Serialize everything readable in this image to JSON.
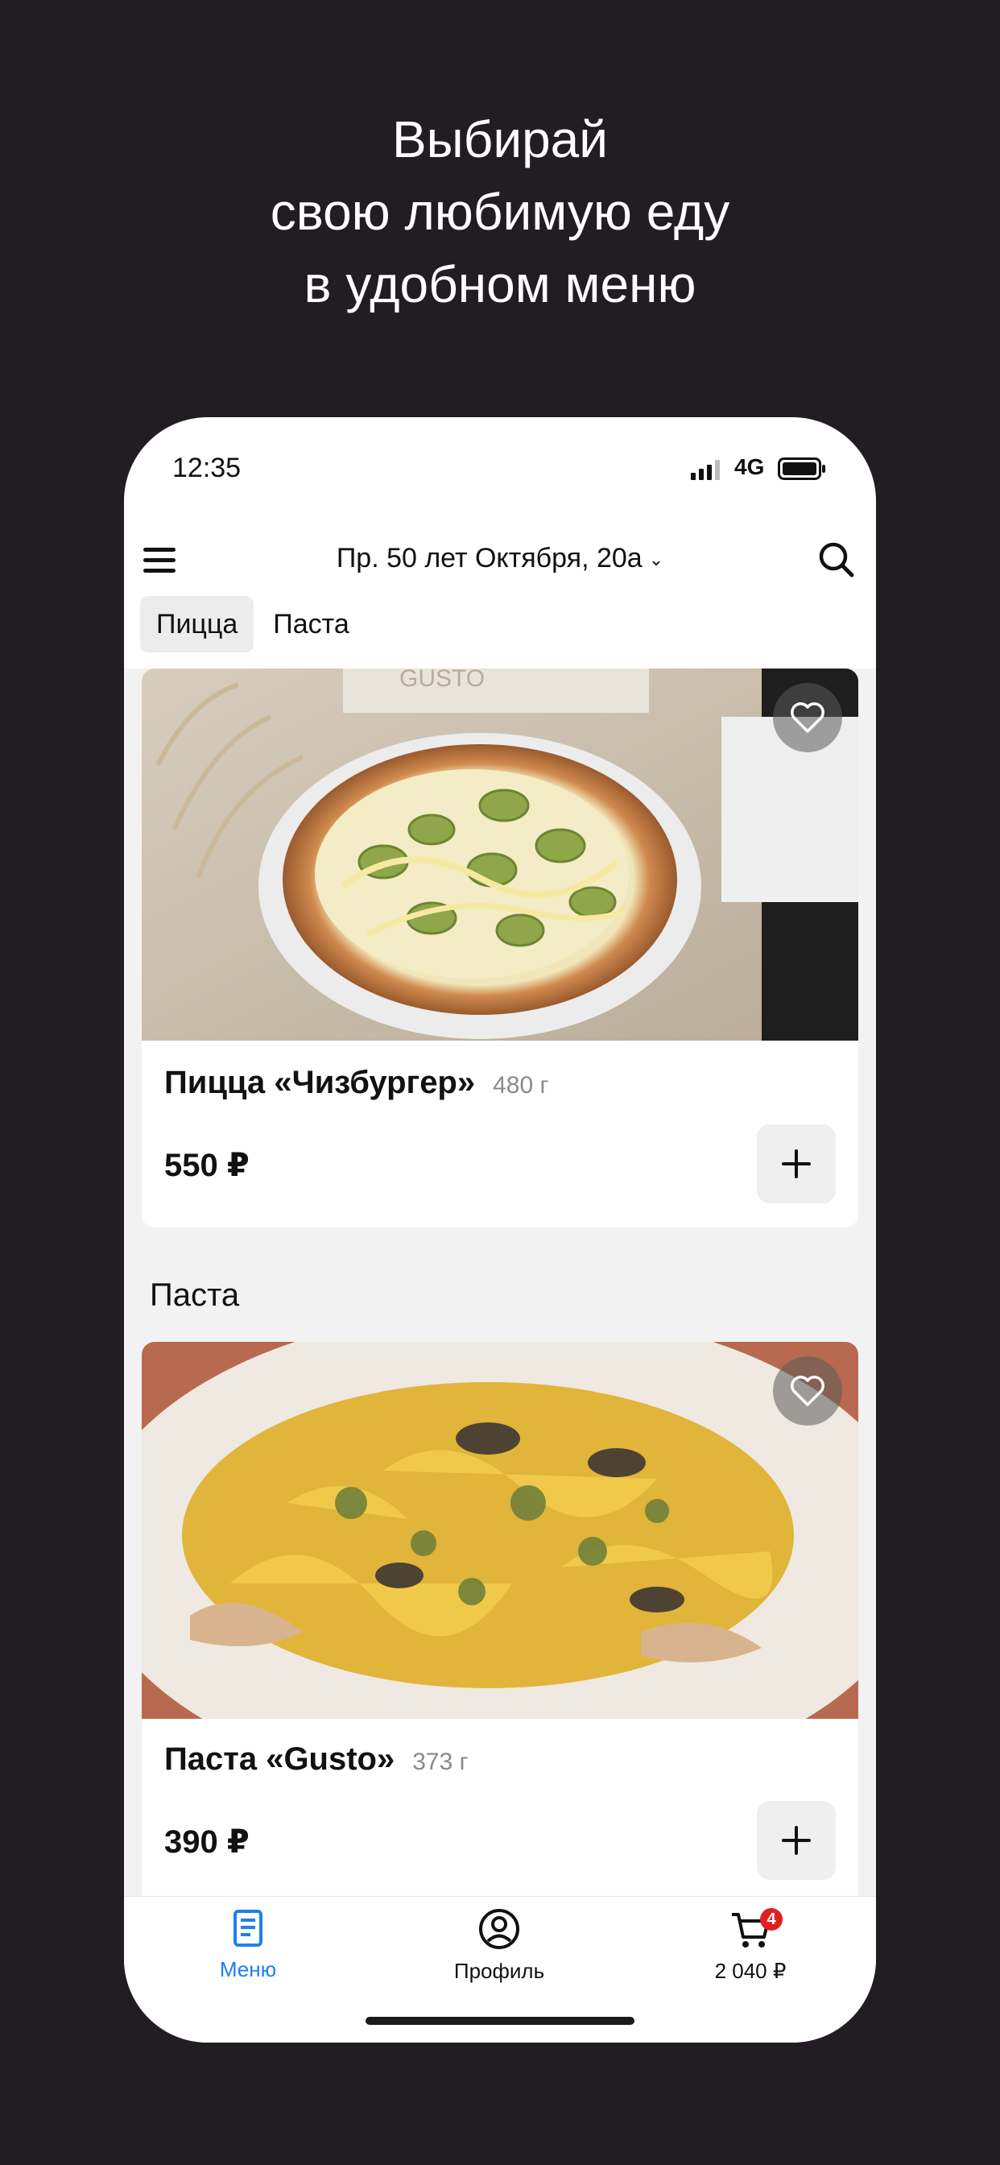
{
  "headline": {
    "line1": "Выбирай",
    "line2": "свою любимую еду",
    "line3": "в удобном меню"
  },
  "status_bar": {
    "time": "12:35",
    "network": "4G"
  },
  "top_bar": {
    "address": "Пр. 50 лет Октября, 20а",
    "menu_icon": "hamburger-icon",
    "search_icon": "search-icon"
  },
  "category_tabs": [
    {
      "label": "Пицца",
      "active": true
    },
    {
      "label": "Паста",
      "active": false
    }
  ],
  "products": [
    {
      "name": "Пицца «Чизбургер»",
      "weight": "480 г",
      "price": "550 ₽"
    },
    {
      "name": "Паста «Gusto»",
      "weight": "373 г",
      "price": "390 ₽"
    }
  ],
  "sections": {
    "pasta_title": "Паста"
  },
  "bottom_nav": {
    "menu_label": "Меню",
    "profile_label": "Профиль",
    "cart_total": "2 040 ₽",
    "cart_count": "4"
  },
  "colors": {
    "background": "#221d23",
    "accent": "#1e7ff0",
    "badge": "#e02020"
  },
  "photo_watermark": "GUSTO"
}
